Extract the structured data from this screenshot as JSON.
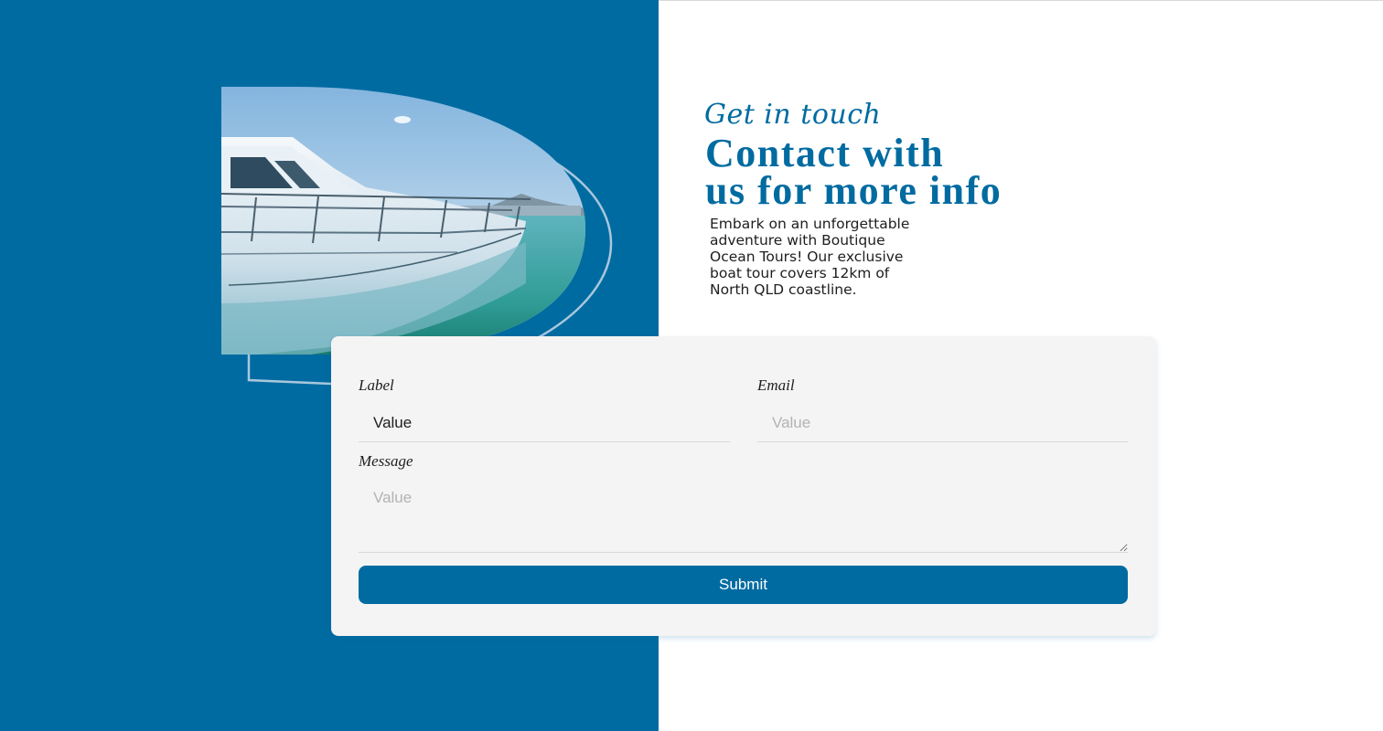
{
  "hero": {
    "eyebrow": "Get in touch",
    "headline_line1": "Contact with",
    "headline_line2": "us for more info",
    "intro": "Embark on an unforgettable adventure with Boutique Ocean Tours! Our exclusive boat tour covers 12km of North QLD coastline.",
    "image": "yacht-photo"
  },
  "form": {
    "name_label": "Label",
    "name_value": "Value",
    "email_label": "Email",
    "email_placeholder": "Value",
    "message_label": "Message",
    "message_placeholder": "Value",
    "submit_label": "Submit"
  },
  "colors": {
    "brand_blue": "#006ba1",
    "card_bg": "#f4f4f4",
    "text": "#1e1e1e",
    "placeholder": "#b3b3b3"
  }
}
